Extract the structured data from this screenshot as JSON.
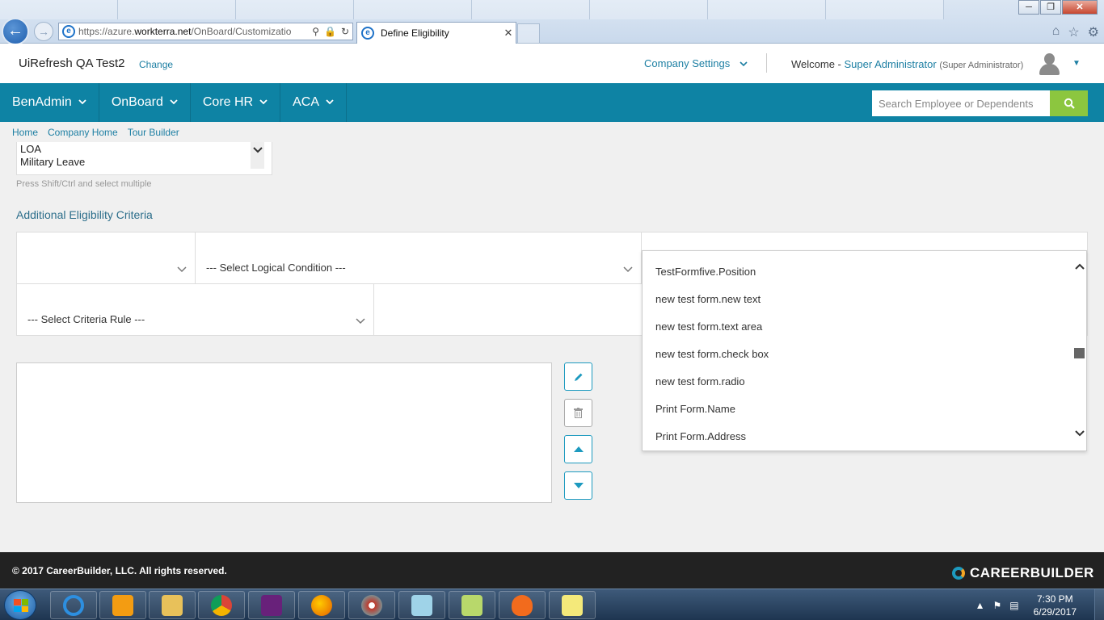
{
  "browser": {
    "background_tabs": [
      "",
      "",
      "",
      "",
      "",
      "",
      "",
      ""
    ],
    "address_url_prefix": "https://azure.",
    "address_url_domain": "workterra.net",
    "address_url_path": "/OnBoard/Customizatio",
    "active_tab_title": "Define Eligibility",
    "window_buttons": [
      "─",
      "❐",
      "✕"
    ]
  },
  "header": {
    "company_name": "UiRefresh QA Test2",
    "change_label": "Change",
    "company_settings_label": "Company Settings",
    "welcome_label": "Welcome -",
    "user_name": "Super Administrator",
    "user_role": "(Super Administrator)"
  },
  "nav": {
    "items": [
      {
        "label": "BenAdmin"
      },
      {
        "label": "OnBoard"
      },
      {
        "label": "Core HR"
      },
      {
        "label": "ACA"
      }
    ],
    "search_placeholder": "Search Employee or Dependents"
  },
  "breadcrumb": [
    "Home",
    "Company Home",
    "Tour Builder"
  ],
  "listbox": {
    "options": [
      "LOA",
      "Military Leave"
    ],
    "hint": "Press Shift/Ctrl and select multiple"
  },
  "section_title": "Additional Eligibility Criteria",
  "criteria": {
    "logical_condition_placeholder": "--- Select Logical Condition ---",
    "criteria_rule_placeholder": "--- Select Criteria Rule ---"
  },
  "dropdown": {
    "items": [
      "TestFormfive.Position",
      "new test form.new text",
      "new test form.text area",
      "new test form.check box",
      "new test form.radio",
      "Print Form.Name",
      "Print Form.Address"
    ]
  },
  "footer": {
    "copyright": "© 2017 CareerBuilder, LLC. All rights reserved.",
    "logo_text": "CAREERBUILDER"
  },
  "taskbar": {
    "time": "7:30 PM",
    "date": "6/29/2017"
  },
  "colors": {
    "nav_bg": "#0e83a4",
    "link": "#1d7fa3",
    "search_button": "#8cc63f",
    "footer_bg": "#222222"
  }
}
